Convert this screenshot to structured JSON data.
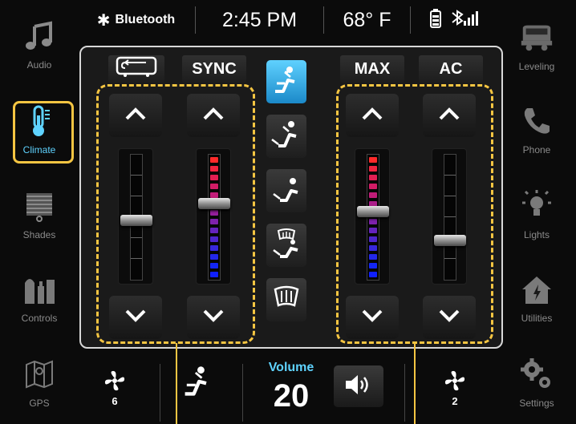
{
  "status": {
    "bluetooth_label": "Bluetooth",
    "time": "2:45 PM",
    "temperature": "68° F"
  },
  "nav_left": [
    {
      "label": "Audio",
      "icon": "music-note-icon"
    },
    {
      "label": "Climate",
      "icon": "thermometer-icon",
      "active": true
    },
    {
      "label": "Shades",
      "icon": "shades-icon"
    },
    {
      "label": "Controls",
      "icon": "controls-icon"
    },
    {
      "label": "GPS",
      "icon": "map-icon"
    }
  ],
  "nav_right": [
    {
      "label": "Leveling",
      "icon": "rv-leveling-icon"
    },
    {
      "label": "Phone",
      "icon": "phone-icon"
    },
    {
      "label": "Lights",
      "icon": "lightbulb-icon"
    },
    {
      "label": "Utilities",
      "icon": "utilities-house-icon"
    },
    {
      "label": "Settings",
      "icon": "gears-icon"
    }
  ],
  "climate": {
    "recirculate_icon": "recirculate-icon",
    "sync_label": "SYNC",
    "max_label": "MAX",
    "ac_label": "AC",
    "left_fan_level": 0.47,
    "left_temp_level": 0.62,
    "right_temp_level": 0.55,
    "right_fan_level": 0.3,
    "modes": [
      "face-vent-icon",
      "face-floor-vent-icon",
      "floor-vent-icon",
      "defrost-floor-icon",
      "defrost-icon"
    ],
    "active_mode": 0
  },
  "bottom": {
    "left_fan_speed": "6",
    "volume_label": "Volume",
    "volume_value": "20",
    "right_fan_speed": "2"
  },
  "colors": {
    "accent": "#5fd3ff",
    "highlight": "#f5c542"
  }
}
